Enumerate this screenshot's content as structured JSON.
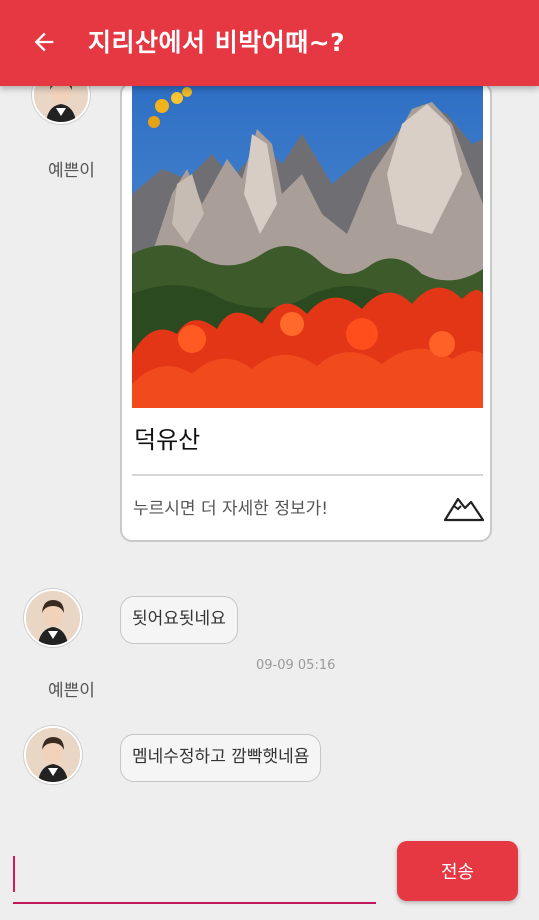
{
  "app_bar": {
    "title": "지리산에서 비박어때~?",
    "back_icon": "arrow-left-icon",
    "color": "#e53843"
  },
  "messages": [
    {
      "type": "card",
      "sender": "예쁜이",
      "card": {
        "title": "덕유산",
        "description": "누르시면 더 자세한 정보가!",
        "icon": "mountain-icon"
      }
    },
    {
      "type": "text",
      "sender": "예쁜이",
      "text": "됫어요됫네요",
      "time": "09-09 05:16"
    },
    {
      "type": "text",
      "text": "멤네수정하고 깜빡햇네욤"
    }
  ],
  "composer": {
    "value": "",
    "send_label": "전송",
    "accent": "#d81b60"
  }
}
